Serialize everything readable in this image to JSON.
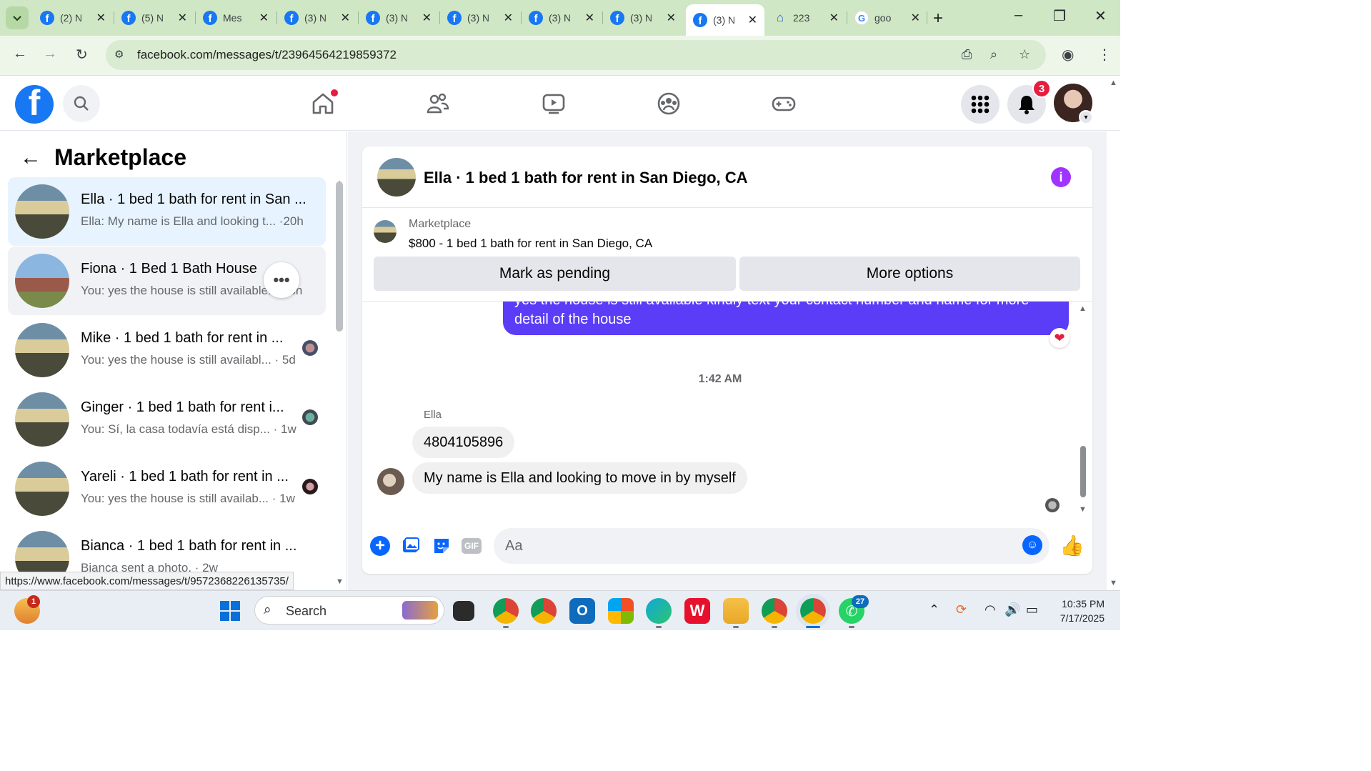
{
  "browser": {
    "tabs": [
      {
        "title": "(2) N",
        "icon": "facebook-icon"
      },
      {
        "title": "(5) N",
        "icon": "facebook-icon"
      },
      {
        "title": "Mes",
        "icon": "facebook-icon"
      },
      {
        "title": "(3) N",
        "icon": "facebook-icon"
      },
      {
        "title": "(3) N",
        "icon": "facebook-icon"
      },
      {
        "title": "(3) N",
        "icon": "facebook-icon"
      },
      {
        "title": "(3) N",
        "icon": "facebook-icon"
      },
      {
        "title": "(3) N",
        "icon": "facebook-icon"
      },
      {
        "title": "(3) N",
        "icon": "facebook-icon",
        "active": true
      },
      {
        "title": "223",
        "icon": "zillow-icon"
      },
      {
        "title": "goo",
        "icon": "google-icon"
      }
    ],
    "url": "facebook.com/messages/t/23964564219859372",
    "status_url": "https://www.facebook.com/messages/t/9572368226135735/"
  },
  "fb_nav": {
    "notification_count": "3"
  },
  "sidebar": {
    "title": "Marketplace",
    "conversations": [
      {
        "name": "Ella · 1 bed 1 bath for rent in San ...",
        "preview": "Ella: My name is Ella and looking t... ·20h",
        "selected": true
      },
      {
        "name": "Fiona · 1 Bed 1 Bath House",
        "preview": "You: yes the house is still available... · 3h"
      },
      {
        "name": "Mike · 1 bed 1 bath for rent in ...",
        "preview": "You: yes the house is still availabl... · 5d"
      },
      {
        "name": "Ginger · 1 bed 1 bath for rent i...",
        "preview": "You: Sí, la casa todavía está disp... · 1w"
      },
      {
        "name": "Yareli · 1 bed 1 bath for rent in ...",
        "preview": "You: yes the house is still availab... · 1w"
      },
      {
        "name": "Bianca · 1 bed 1 bath for rent in ...",
        "preview": "Bianca sent a photo. · 2w"
      }
    ]
  },
  "chat": {
    "title": "Ella · 1 bed 1 bath for rent in San Diego, CA",
    "listing_source": "Marketplace",
    "listing": "$800 - 1 bed 1 bath for rent in San Diego, CA",
    "btn_pending": "Mark as pending",
    "btn_more": "More options",
    "outgoing_line1": "yes the house is still available kindly text your contact number and name for more",
    "outgoing_line2": "detail of the house",
    "timestamp": "1:42 AM",
    "sender": "Ella",
    "msg1": "4804105896",
    "msg2": "My name is Ella and looking to move in by myself",
    "input_placeholder": "Aa",
    "gif_label": "GIF"
  },
  "taskbar": {
    "search_label": "Search",
    "time": "10:35 PM",
    "date": "7/17/2025",
    "badge_widget": "1",
    "badge_whatsapp": "27"
  }
}
